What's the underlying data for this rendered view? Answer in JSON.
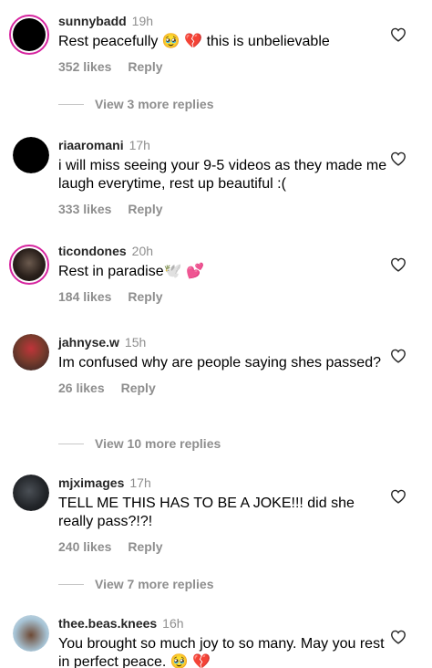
{
  "comments": [
    {
      "user": "sunnybadd",
      "time": "19h",
      "text": "Rest peacefully 🥹 💔  this is unbelievable",
      "likes": "352 likes",
      "reply": "Reply"
    },
    {
      "user": "riaaromani",
      "time": "17h",
      "text": "i will miss seeing your 9-5 videos as they made me laugh everytime, rest up beautiful :(",
      "likes": "333 likes",
      "reply": "Reply"
    },
    {
      "user": "ticondones",
      "time": "20h",
      "text": "Rest in paradise🕊️ 💕",
      "likes": "184 likes",
      "reply": "Reply"
    },
    {
      "user": "jahnyse.w",
      "time": "15h",
      "text": "Im confused why are people saying shes passed?",
      "likes": "26 likes",
      "reply": "Reply"
    },
    {
      "user": "mjximages",
      "time": "17h",
      "text": "TELL ME THIS HAS TO BE A JOKE!!! did she really pass?!?!",
      "likes": "240 likes",
      "reply": "Reply"
    },
    {
      "user": "thee.beas.knees",
      "time": "16h",
      "text": "You brought so much joy to so many. May you rest in perfect peace. 🥹 💔",
      "likes": "",
      "reply": ""
    }
  ],
  "view_more": [
    "View 3 more replies",
    "View 10 more replies",
    "View 7 more replies"
  ],
  "icons": {
    "like": "heart-outline-icon"
  },
  "colors": {
    "username": "#262626",
    "secondary": "#8e8e8e",
    "story_ring": "#d6249f"
  }
}
